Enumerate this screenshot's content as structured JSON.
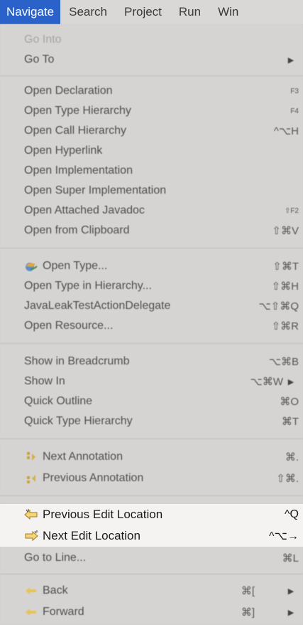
{
  "menubar": {
    "navigate": "Navigate",
    "search": "Search",
    "project": "Project",
    "run": "Run",
    "window": "Win"
  },
  "menu": {
    "go_into": "Go Into",
    "go_to": "Go To",
    "open_declaration": {
      "label": "Open Declaration",
      "shortcut": "F3"
    },
    "open_type_hierarchy": {
      "label": "Open Type Hierarchy",
      "shortcut": "F4"
    },
    "open_call_hierarchy": {
      "label": "Open Call Hierarchy",
      "shortcut": "^⌥H"
    },
    "open_hyperlink": "Open Hyperlink",
    "open_implementation": "Open Implementation",
    "open_super_implementation": "Open Super Implementation",
    "open_attached_javadoc": {
      "label": "Open Attached Javadoc",
      "shortcut": "⇧F2"
    },
    "open_from_clipboard": {
      "label": "Open from Clipboard",
      "shortcut": "⇧⌘V"
    },
    "open_type": {
      "label": "Open Type...",
      "shortcut": "⇧⌘T"
    },
    "open_type_in_hierarchy": {
      "label": "Open Type in Hierarchy...",
      "shortcut": "⇧⌘H"
    },
    "java_leak": {
      "label": "JavaLeakTestActionDelegate",
      "shortcut": "⌥⇧⌘Q"
    },
    "open_resource": {
      "label": "Open Resource...",
      "shortcut": "⇧⌘R"
    },
    "show_in_breadcrumb": {
      "label": "Show in Breadcrumb",
      "shortcut": "⌥⌘B"
    },
    "show_in": {
      "label": "Show In",
      "shortcut": "⌥⌘W"
    },
    "quick_outline": {
      "label": "Quick Outline",
      "shortcut": "⌘O"
    },
    "quick_type_hierarchy": {
      "label": "Quick Type Hierarchy",
      "shortcut": "⌘T"
    },
    "next_annotation": {
      "label": "Next Annotation",
      "shortcut": "⌘."
    },
    "previous_annotation": {
      "label": "Previous Annotation",
      "shortcut": "⇧⌘."
    },
    "previous_edit_location": {
      "label": "Previous Edit Location",
      "shortcut": "^Q"
    },
    "next_edit_location": {
      "label": "Next Edit Location",
      "shortcut": "^⌥→"
    },
    "go_to_line": {
      "label": "Go to Line...",
      "shortcut": "⌘L"
    },
    "back": {
      "label": "Back",
      "shortcut": "⌘["
    },
    "forward": {
      "label": "Forward",
      "shortcut": "⌘]"
    }
  },
  "colors": {
    "menubar_active": "#2a62c9",
    "highlight_band": "#f5f3f1"
  },
  "icons": {
    "submenu": "submenu-arrow-icon",
    "open_type": "open-type-icon",
    "next_annotation": "next-annotation-icon",
    "previous_annotation": "previous-annotation-icon",
    "previous_edit": "previous-edit-location-icon",
    "next_edit": "next-edit-location-icon",
    "back": "back-arrow-icon",
    "forward": "forward-arrow-icon"
  }
}
